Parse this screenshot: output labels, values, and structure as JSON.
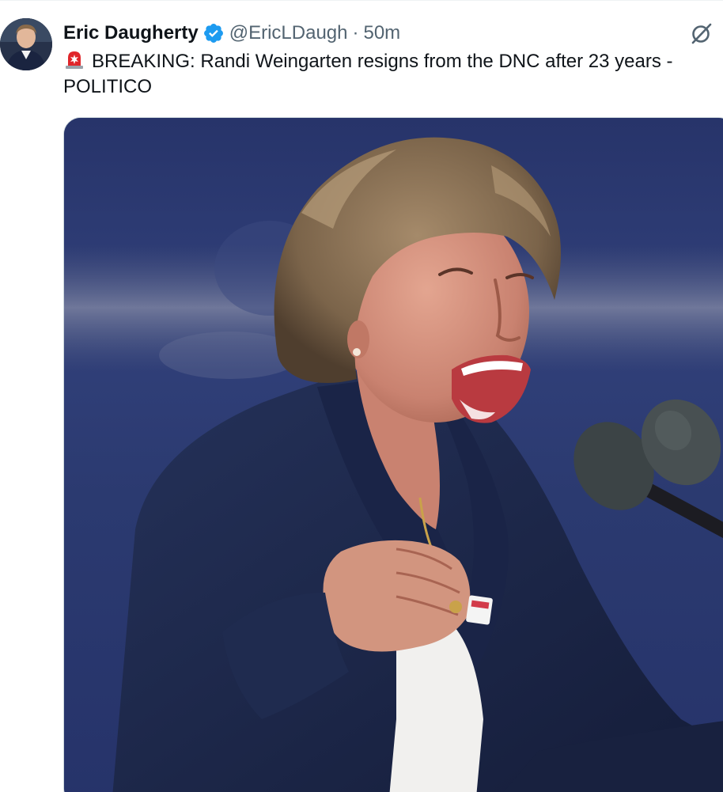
{
  "tweet": {
    "author_name": "Eric Daugherty",
    "handle": "@EricLDaugh",
    "separator": "·",
    "time": "50m",
    "text": "BREAKING: Randi Weingarten resigns from the DNC after 23 years - POLITICO",
    "verified": true,
    "icons": {
      "verified": "verified-badge-icon",
      "siren": "police-light-emoji",
      "grok": "grok-icon"
    },
    "colors": {
      "verified_badge": "#1d9bf0",
      "secondary_text": "#536471",
      "siren_red": "#e0262b"
    }
  }
}
